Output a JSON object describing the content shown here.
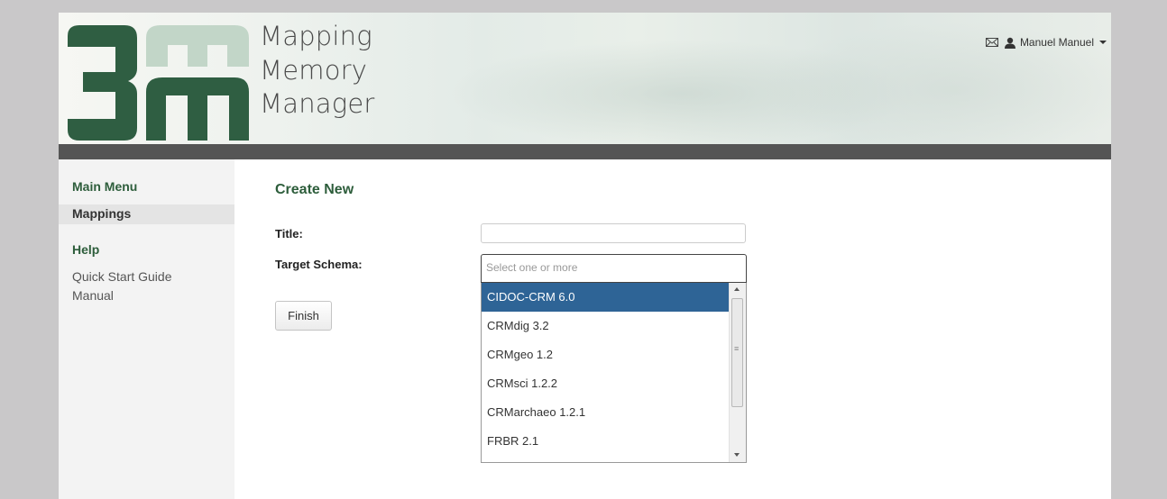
{
  "header": {
    "brand_lines": [
      "Mapping",
      "Memory",
      "Manager"
    ],
    "user_name": "Manuel Manuel",
    "icons": {
      "messages": "envelope-icon",
      "user": "user-icon",
      "menu": "caret-down-icon"
    },
    "logo_text": "3m"
  },
  "sidebar": {
    "main_heading": "Main Menu",
    "main_items": [
      {
        "label": "Mappings",
        "active": true
      }
    ],
    "help_heading": "Help",
    "help_items": [
      {
        "label": "Quick Start Guide"
      },
      {
        "label": "Manual"
      }
    ]
  },
  "main": {
    "title": "Create New",
    "title_label": "Title:",
    "title_value": "",
    "schema_label": "Target Schema:",
    "schema_placeholder": "Select one or more",
    "schema_options": [
      {
        "label": "CIDOC-CRM 6.0",
        "highlighted": true
      },
      {
        "label": "CRMdig 3.2"
      },
      {
        "label": "CRMgeo 1.2"
      },
      {
        "label": "CRMsci 1.2.2"
      },
      {
        "label": "CRMarchaeo 1.2.1"
      },
      {
        "label": "FRBR 2.1"
      }
    ],
    "finish_label": "Finish"
  },
  "colors": {
    "brand_green": "#2d5d3b",
    "logo_dark_green": "#2f5e42",
    "logo_light_green": "#c2d6c8",
    "highlight_blue": "#2e6496",
    "header_bar": "#555555",
    "outer_background": "#c9c8c9"
  }
}
